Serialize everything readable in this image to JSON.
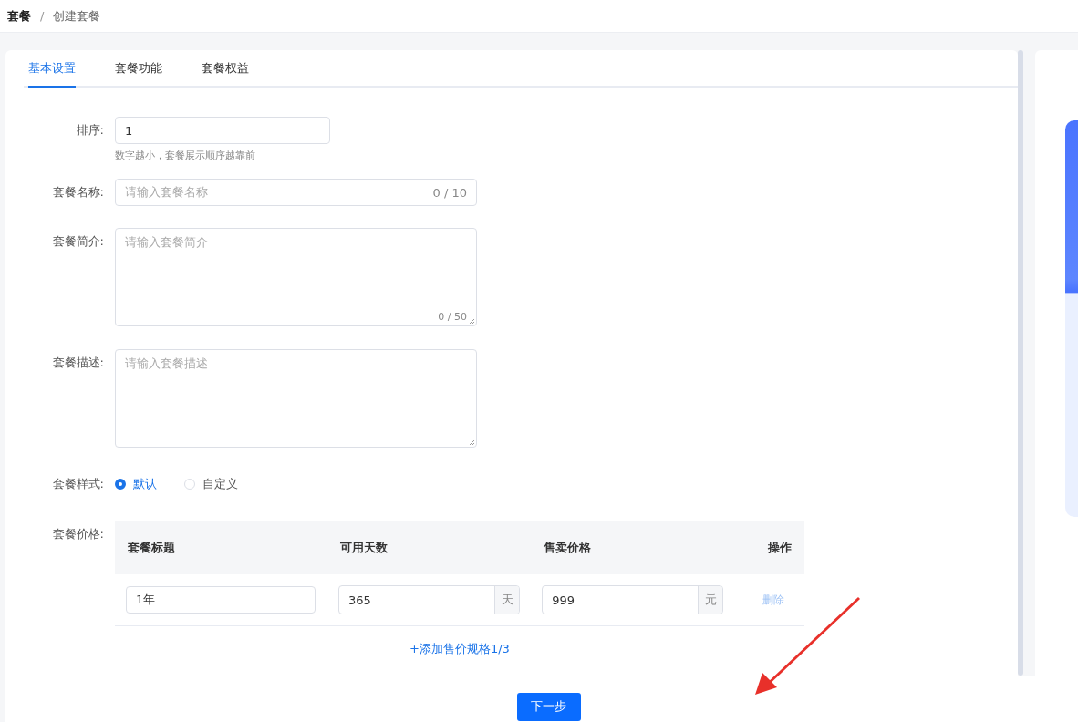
{
  "breadcrumb": {
    "items": [
      "套餐",
      "创建套餐"
    ],
    "separator": "/"
  },
  "tabs": [
    {
      "label": "基本设置",
      "selected": true
    },
    {
      "label": "套餐功能",
      "selected": false
    },
    {
      "label": "套餐权益",
      "selected": false
    }
  ],
  "form": {
    "sort": {
      "label": "排序:",
      "value": "1",
      "hint": "数字越小，套餐展示顺序越靠前"
    },
    "name": {
      "label": "套餐名称:",
      "placeholder": "请输入套餐名称",
      "counter": "0 / 10"
    },
    "intro": {
      "label": "套餐简介:",
      "placeholder": "请输入套餐简介",
      "counter": "0 / 50"
    },
    "description": {
      "label": "套餐描述:",
      "placeholder": "请输入套餐描述"
    },
    "style": {
      "label": "套餐样式:",
      "options": [
        {
          "label": "默认",
          "selected": true
        },
        {
          "label": "自定义",
          "selected": false
        }
      ]
    },
    "price": {
      "label": "套餐价格:",
      "columns": [
        "套餐标题",
        "可用天数",
        "售卖价格",
        "操作"
      ],
      "rows": [
        {
          "title": "1年",
          "days": "365",
          "days_unit": "天",
          "price": "999",
          "price_unit": "元",
          "action": "删除"
        }
      ],
      "add_link": "+添加售价规格1/3"
    }
  },
  "next_button": "下一步"
}
